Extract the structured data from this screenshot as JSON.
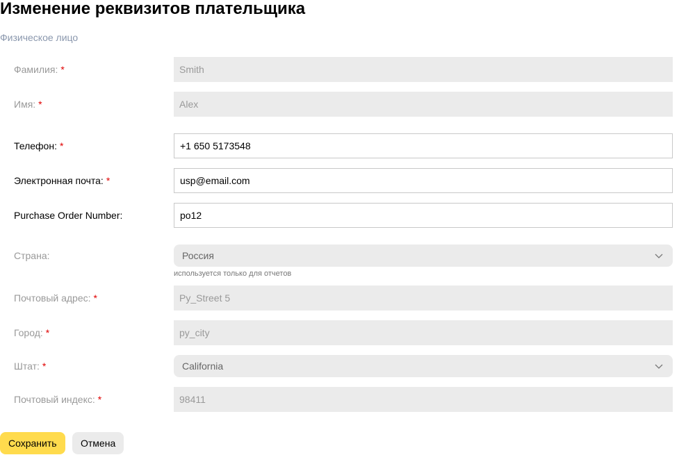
{
  "page": {
    "title": "Изменение реквизитов плательщика",
    "subtitle": "Физическое лицо"
  },
  "form": {
    "required_mark": "*",
    "last_name": {
      "label": "Фамилия:",
      "value": "Smith",
      "required": true,
      "editable": false
    },
    "first_name": {
      "label": "Имя:",
      "value": "Alex",
      "required": true,
      "editable": false
    },
    "phone": {
      "label": "Телефон:",
      "value": "+1 650 5173548",
      "required": true,
      "editable": true
    },
    "email": {
      "label": "Электронная почта:",
      "value": "usp@email.com",
      "required": true,
      "editable": true
    },
    "po_number": {
      "label": "Purchase Order Number:",
      "value": "po12",
      "required": false,
      "editable": true
    },
    "country": {
      "label": "Страна:",
      "value": "Россия",
      "hint": "используется только для отчетов",
      "required": false,
      "editable": false,
      "icon": "chevron-down-icon"
    },
    "postal_address": {
      "label": "Почтовый адрес:",
      "value": "Py_Street 5",
      "required": true,
      "editable": false
    },
    "city": {
      "label": "Город:",
      "value": "py_city",
      "required": true,
      "editable": false
    },
    "state": {
      "label": "Штат:",
      "value": "California",
      "required": true,
      "editable": false,
      "icon": "chevron-down-icon"
    },
    "postal_code": {
      "label": "Почтовый индекс:",
      "value": "98411",
      "required": true,
      "editable": false
    }
  },
  "actions": {
    "save_label": "Сохранить",
    "cancel_label": "Отмена"
  },
  "colors": {
    "save_button": "#ffdb4d",
    "required_mark": "#e00000",
    "subtitle": "#8a97ad",
    "disabled_field": "#ebebeb"
  }
}
